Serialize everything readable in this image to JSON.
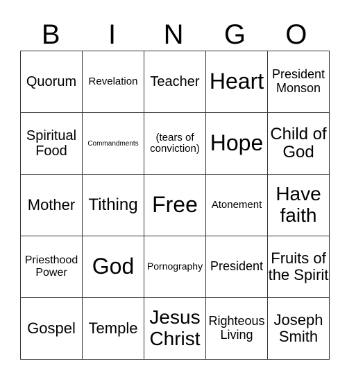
{
  "header": [
    "B",
    "I",
    "N",
    "G",
    "O"
  ],
  "cells": [
    [
      "Quorum",
      "Revelation",
      "Teacher",
      "Heart",
      "President Monson"
    ],
    [
      "Spiritual Food",
      "Commandments",
      "(tears of conviction)",
      "Hope",
      "Child of God"
    ],
    [
      "Mother",
      "Tithing",
      "Free",
      "Atonement",
      "Have faith"
    ],
    [
      "Priesthood Power",
      "God",
      "Pornography",
      "President",
      "Fruits of the Spirit"
    ],
    [
      "Gospel",
      "Temple",
      "Jesus Christ",
      "Righteous Living",
      "Joseph Smith"
    ]
  ]
}
